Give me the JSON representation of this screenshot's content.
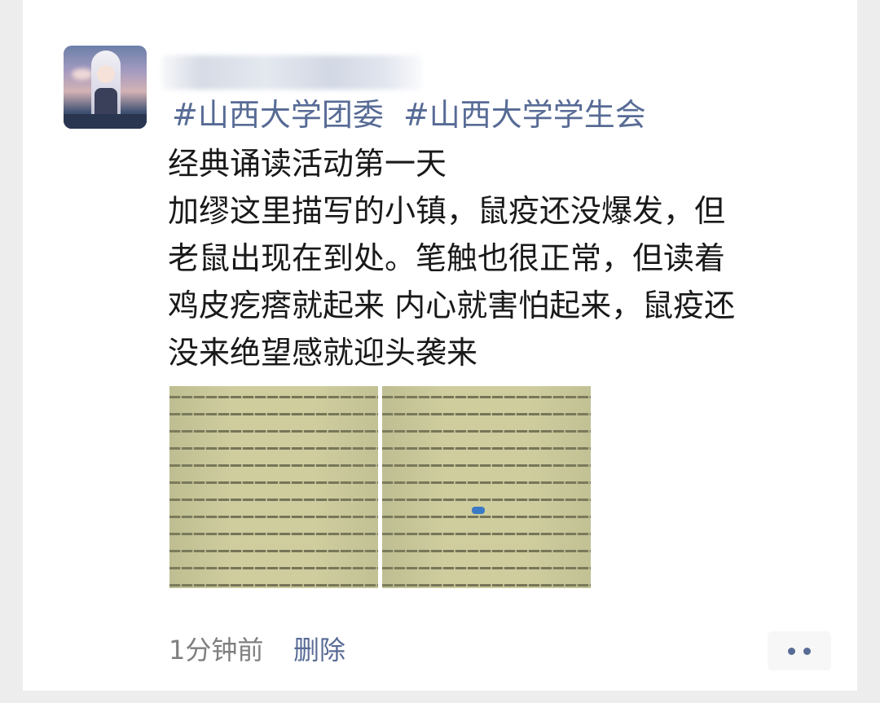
{
  "post": {
    "author_name": "",
    "tags": [
      "#山西大学团委",
      "#山西大学学生会"
    ],
    "lines": [
      "经典诵读活动第一天",
      "加缪这里描写的小镇，鼠疫还没爆发，但",
      "老鼠出现在到处。笔触也很正常，但读着",
      "鸡皮疙瘩就起来 内心就害怕起来，鼠疫还",
      "没来绝望感就迎头袭来"
    ],
    "photos": [
      "book-page-photo",
      "book-page-photo"
    ],
    "time": "1分钟前",
    "delete_label": "删除",
    "more_icon": "more-dots-icon"
  },
  "colors": {
    "link": "#576b95",
    "text": "#191919",
    "meta": "#7f7f7f",
    "background": "#ededed",
    "card": "#ffffff"
  }
}
